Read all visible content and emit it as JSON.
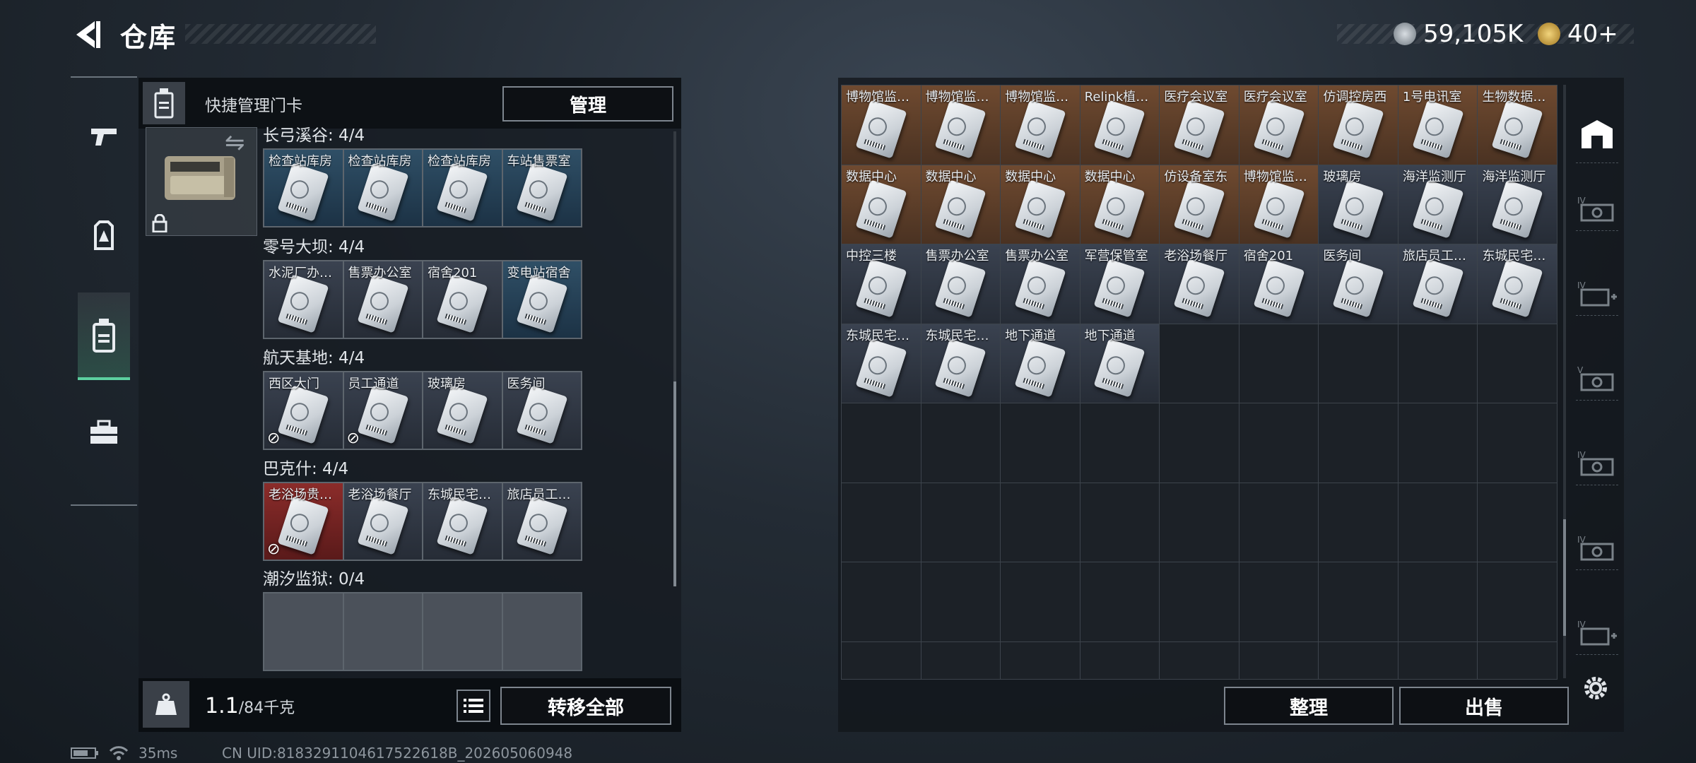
{
  "header": {
    "title": "仓库",
    "currency1": "59,105K",
    "currency2": "40+"
  },
  "nav": {
    "items": [
      "weapon-icon",
      "armor-icon",
      "keycard-icon",
      "toolbox-icon"
    ],
    "active": 2
  },
  "left_panel": {
    "header_label": "快捷管理门卡",
    "manage_label": "管理",
    "groups": [
      {
        "title": "长弓溪谷: 4/4",
        "slots": [
          {
            "label": "检查站库房",
            "bg": "blue"
          },
          {
            "label": "检查站库房",
            "bg": "blue"
          },
          {
            "label": "检查站库房",
            "bg": "blue"
          },
          {
            "label": "车站售票室",
            "bg": "blue"
          }
        ]
      },
      {
        "title": "零号大坝: 4/4",
        "slots": [
          {
            "label": "水泥厂办…",
            "bg": "gray"
          },
          {
            "label": "售票办公室",
            "bg": "gray"
          },
          {
            "label": "宿舍201",
            "bg": "gray"
          },
          {
            "label": "变电站宿舍",
            "bg": "blue"
          }
        ]
      },
      {
        "title": "航天基地: 4/4",
        "slots": [
          {
            "label": "西区大门",
            "bg": "gray",
            "nosell": true
          },
          {
            "label": "员工通道",
            "bg": "gray",
            "nosell": true
          },
          {
            "label": "玻璃房",
            "bg": "gray"
          },
          {
            "label": "医务间",
            "bg": "gray"
          }
        ]
      },
      {
        "title": "巴克什: 4/4",
        "slots": [
          {
            "label": "老浴场贵…",
            "bg": "red",
            "nosell": true
          },
          {
            "label": "老浴场餐厅",
            "bg": "gray"
          },
          {
            "label": "东城民宅…",
            "bg": "gray"
          },
          {
            "label": "旅店员工…",
            "bg": "gray"
          }
        ]
      },
      {
        "title": "潮汐监狱: 0/4",
        "slots": [
          {
            "label": "",
            "bg": "empty"
          },
          {
            "label": "",
            "bg": "empty"
          },
          {
            "label": "",
            "bg": "empty"
          },
          {
            "label": "",
            "bg": "empty"
          }
        ]
      }
    ],
    "weight_value": "1.1",
    "weight_unit": "/84千克",
    "transfer_label": "转移全部"
  },
  "right_panel": {
    "cells": [
      {
        "label": "博物馆监…",
        "bg": "brown"
      },
      {
        "label": "博物馆监…",
        "bg": "brown"
      },
      {
        "label": "博物馆监…",
        "bg": "brown"
      },
      {
        "label": "Relink植…",
        "bg": "brown"
      },
      {
        "label": "医疗会议室",
        "bg": "brown"
      },
      {
        "label": "医疗会议室",
        "bg": "brown"
      },
      {
        "label": "仿调控房西",
        "bg": "brown"
      },
      {
        "label": "1号电讯室",
        "bg": "brown"
      },
      {
        "label": "生物数据…",
        "bg": "brown"
      },
      {
        "label": "数据中心",
        "bg": "brown"
      },
      {
        "label": "数据中心",
        "bg": "brown"
      },
      {
        "label": "数据中心",
        "bg": "brown"
      },
      {
        "label": "数据中心",
        "bg": "brown"
      },
      {
        "label": "仿设备室东",
        "bg": "brown"
      },
      {
        "label": "博物馆监…",
        "bg": "brown"
      },
      {
        "label": "玻璃房",
        "bg": "gray"
      },
      {
        "label": "海洋监测厅",
        "bg": "gray"
      },
      {
        "label": "海洋监测厅",
        "bg": "gray"
      },
      {
        "label": "中控三楼",
        "bg": "gray"
      },
      {
        "label": "售票办公室",
        "bg": "gray"
      },
      {
        "label": "售票办公室",
        "bg": "gray"
      },
      {
        "label": "军营保管室",
        "bg": "gray"
      },
      {
        "label": "老浴场餐厅",
        "bg": "gray"
      },
      {
        "label": "宿舍201",
        "bg": "gray"
      },
      {
        "label": "医务间",
        "bg": "gray"
      },
      {
        "label": "旅店员工…",
        "bg": "gray"
      },
      {
        "label": "东城民宅…",
        "bg": "gray"
      },
      {
        "label": "东城民宅…",
        "bg": "gray"
      },
      {
        "label": "东城民宅…",
        "bg": "gray"
      },
      {
        "label": "地下通道",
        "bg": "gray"
      },
      {
        "label": "地下通道",
        "bg": "gray"
      }
    ],
    "total_cells": 72,
    "sort_label": "整理",
    "sell_label": "出售"
  },
  "rail": {
    "items": [
      "vault-icon",
      "expand-iv-icon",
      "add-iv-icon",
      "expand-v-icon",
      "expand-iv-icon",
      "expand-iv-icon",
      "add-iv-icon"
    ]
  },
  "status": {
    "ping": "35ms",
    "uid": "CN UID:8183291104617522618B_202605060948"
  }
}
